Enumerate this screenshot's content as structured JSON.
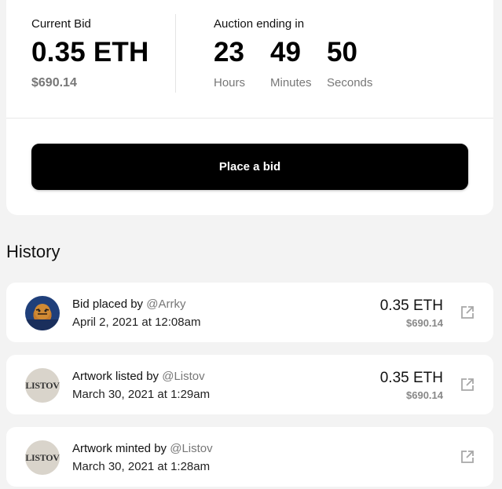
{
  "current_bid": {
    "label": "Current Bid",
    "eth": "0.35 ETH",
    "usd": "$690.14"
  },
  "auction": {
    "label": "Auction ending in",
    "hours": "23",
    "hours_label": "Hours",
    "minutes": "49",
    "minutes_label": "Minutes",
    "seconds": "50",
    "seconds_label": "Seconds"
  },
  "place_bid_label": "Place a bid",
  "history": {
    "title": "History",
    "items": [
      {
        "action": "Bid placed by",
        "user": "@Arrky",
        "date": "April 2, 2021 at 12:08am",
        "eth": "0.35 ETH",
        "usd": "$690.14",
        "avatar": "tiger-avatar"
      },
      {
        "action": "Artwork listed by",
        "user": "@Listov",
        "date": "March 30, 2021 at 1:29am",
        "eth": "0.35 ETH",
        "usd": "$690.14",
        "avatar": "listov-avatar",
        "avatar_text": "LISTOV"
      },
      {
        "action": "Artwork minted by",
        "user": "@Listov",
        "date": "March 30, 2021 at 1:28am",
        "avatar": "listov-avatar",
        "avatar_text": "LISTOV"
      }
    ]
  },
  "icons": {
    "external_link": "external-link-icon"
  }
}
